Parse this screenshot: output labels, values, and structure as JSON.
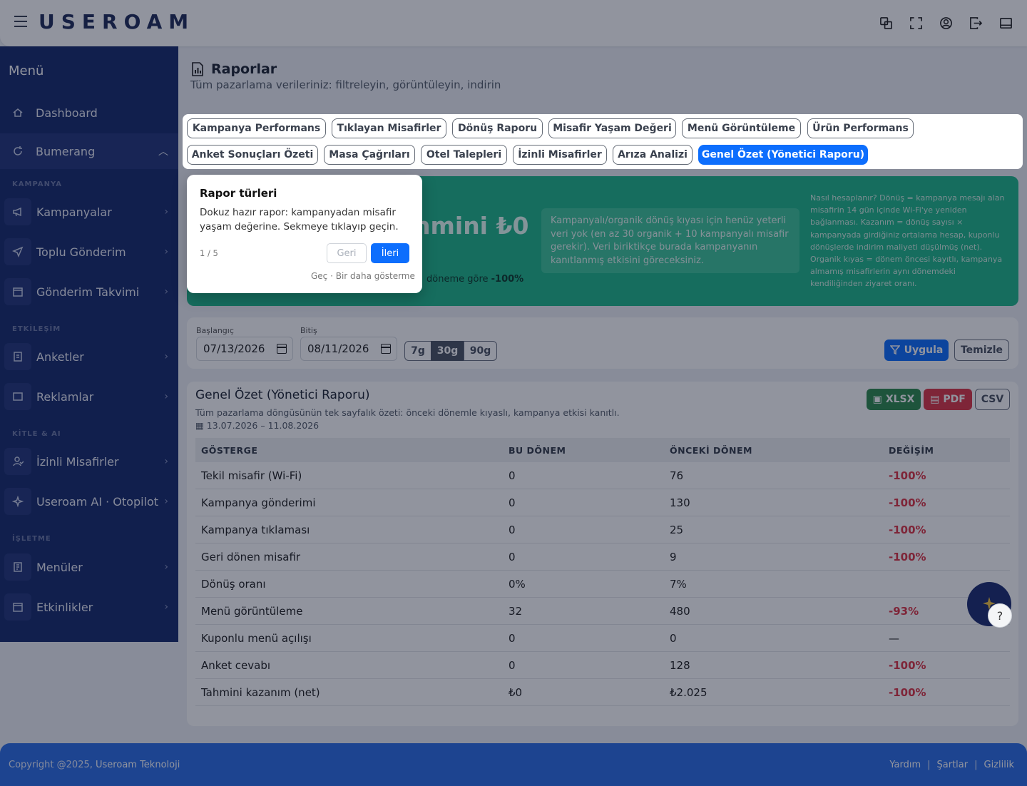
{
  "header": {
    "logo": "USEROAM",
    "icons": [
      "translate-icon",
      "fullscreen-icon",
      "user-icon",
      "logout-icon",
      "panel-icon"
    ]
  },
  "sidebar": {
    "title": "Menü",
    "items": [
      {
        "label": "Dashboard",
        "icon": "home-icon"
      },
      {
        "label": "Bumerang",
        "icon": "refresh-icon"
      },
      {
        "label": "Kampanyalar",
        "icon": "megaphone-icon"
      },
      {
        "label": "Toplu Gönderim",
        "icon": "send-icon"
      },
      {
        "label": "Gönderim Takvimi",
        "icon": "calendar-icon"
      },
      {
        "label": "Anketler",
        "icon": "clipboard-icon"
      },
      {
        "label": "Reklamlar",
        "icon": "ad-icon"
      },
      {
        "label": "İzinli Misafirler",
        "icon": "user-check-icon"
      },
      {
        "label": "Useroam AI · Otopilot",
        "icon": "sparkle-icon"
      },
      {
        "label": "Menüler",
        "icon": "menu-doc-icon"
      },
      {
        "label": "Etkinlikler",
        "icon": "event-icon"
      }
    ],
    "sections": [
      "KAMPANYA",
      "ETKİLEŞİM",
      "KİTLE & AI",
      "İŞLETME"
    ]
  },
  "page": {
    "title": "Raporlar",
    "subtitle": "Tüm pazarlama verileriniz: filtreleyin, görüntüleyin, indirin"
  },
  "tabs": [
    "Kampanya Performans",
    "Tıklayan Misafirler",
    "Dönüş Raporu",
    "Misafir Yaşam Değeri",
    "Menü Görüntüleme",
    "Ürün Performans",
    "Anket Sonuçları Özeti",
    "Masa Çağrıları",
    "Otel Talepleri",
    "İzinli Misafirler",
    "Arıza Analizi",
    "Genel Özet (Yönetici Raporu)"
  ],
  "banner": {
    "big_text": "hmini ₺0",
    "delta_prefix": "döneme göre",
    "delta_value": "-100%",
    "notice": "Kampanyalı/organik dönüş kıyası için henüz yeterli veri yok (en az 30 organik + 10 kampanyalı misafir gerekir). Veri biriktikçe burada kampanyanın kanıtlanmış etkisini göreceksiniz.",
    "help": "Nasıl hesaplanır? Dönüş = kampanya mesajı alan misafirin 14 gün içinde Wi-Fi'ye yeniden bağlanması. Kazanım = dönüş sayısı × kampanyada girdiğiniz ortalama hesap, kuponlu dönüşlerde indirim maliyeti düşülmüş (net). Organik kıyas = dönem öncesi kayıtlı, kampanya almamış misafirlerin aynı dönemdeki kendiliğinden ziyaret oranı."
  },
  "filter": {
    "start_label": "Başlangıç",
    "start_value": "07/13/2026",
    "end_label": "Bitiş",
    "end_value": "08/11/2026",
    "ranges": [
      "7g",
      "30g",
      "90g"
    ],
    "apply": "Uygula",
    "clear": "Temizle"
  },
  "report": {
    "title": "Genel Özet (Yönetici Raporu)",
    "subtitle": "Tüm pazarlama döngüsünün tek sayfalık özeti: önceki dönemle kıyaslı, kampanya etkisi kanıtlı.",
    "date_range": "13.07.2026 – 11.08.2026",
    "export_xlsx": "XLSX",
    "export_pdf": "PDF",
    "export_csv": "CSV",
    "columns": [
      "GÖSTERGE",
      "BU DÖNEM",
      "ÖNCEKİ DÖNEM",
      "DEĞİŞİM"
    ],
    "rows": [
      [
        "Tekil misafir (Wi-Fi)",
        "0",
        "76",
        "-100%"
      ],
      [
        "Kampanya gönderimi",
        "0",
        "130",
        "-100%"
      ],
      [
        "Kampanya tıklaması",
        "0",
        "25",
        "-100%"
      ],
      [
        "Geri dönen misafir",
        "0",
        "9",
        "-100%"
      ],
      [
        "Dönüş oranı",
        "0%",
        "7%",
        ""
      ],
      [
        "Menü görüntüleme",
        "32",
        "480",
        "-93%"
      ],
      [
        "Kuponlu menü açılışı",
        "0",
        "0",
        "—"
      ],
      [
        "Anket cevabı",
        "0",
        "128",
        "-100%"
      ],
      [
        "Tahmini kazanım (net)",
        "₺0",
        "₺2.025",
        "-100%"
      ]
    ]
  },
  "tour": {
    "title": "Rapor türleri",
    "body": "Dokuz hazır rapor: kampanyadan misafir yaşam değerine. Sekmeye tıklayıp geçin.",
    "step": "1 / 5",
    "prev": "Geri",
    "next": "İleri",
    "skip": "Geç · Bir daha gösterme"
  },
  "help_button": "?",
  "footer": {
    "copyright_prefix": "Copyright @2025,",
    "company": "Useroam Teknoloji",
    "links": [
      "Yardım",
      "Şartlar",
      "Gizlilik"
    ]
  }
}
